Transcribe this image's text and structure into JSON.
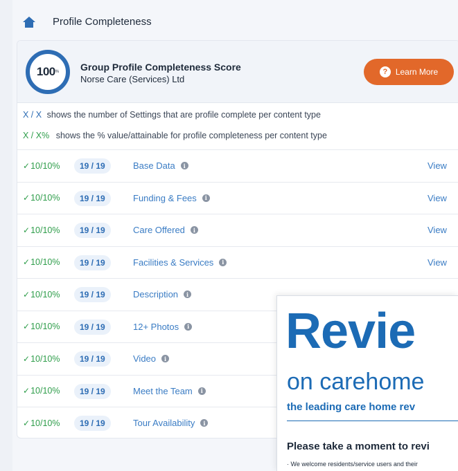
{
  "header": {
    "title": "Profile Completeness",
    "icon": "home-icon"
  },
  "score": {
    "value": "100",
    "suffix": "%",
    "title": "Group Profile Completeness Score",
    "organisation": "Norse Care (Services) Ltd",
    "learn_more_label": "Learn More"
  },
  "legend": {
    "key1": "X / X",
    "text1": "shows the number of Settings that are profile complete per content type",
    "key2": "X / X%",
    "text2": "shows the % value/attainable for profile completeness per content type"
  },
  "rows": [
    {
      "pct": "10/10%",
      "count": "19 / 19",
      "label": "Base Data",
      "view": "View"
    },
    {
      "pct": "10/10%",
      "count": "19 / 19",
      "label": "Funding & Fees",
      "view": "View"
    },
    {
      "pct": "10/10%",
      "count": "19 / 19",
      "label": "Care Offered",
      "view": "View"
    },
    {
      "pct": "10/10%",
      "count": "19 / 19",
      "label": "Facilities & Services",
      "view": "View"
    },
    {
      "pct": "10/10%",
      "count": "19 / 19",
      "label": "Description",
      "view": ""
    },
    {
      "pct": "10/10%",
      "count": "19 / 19",
      "label": "12+ Photos",
      "view": ""
    },
    {
      "pct": "10/10%",
      "count": "19 / 19",
      "label": "Video",
      "view": ""
    },
    {
      "pct": "10/10%",
      "count": "19 / 19",
      "label": "Meet the Team",
      "view": ""
    },
    {
      "pct": "10/10%",
      "count": "19 / 19",
      "label": "Tour Availability",
      "view": ""
    }
  ],
  "overlay": {
    "big": "Revie",
    "mid": "on carehome",
    "small": "the leading care home rev",
    "please": "Please take a moment to revi",
    "bullet": "· We welcome residents/service users and their"
  },
  "colors": {
    "accent": "#2e6db4",
    "button": "#e2682a",
    "success": "#2e9d4a"
  }
}
